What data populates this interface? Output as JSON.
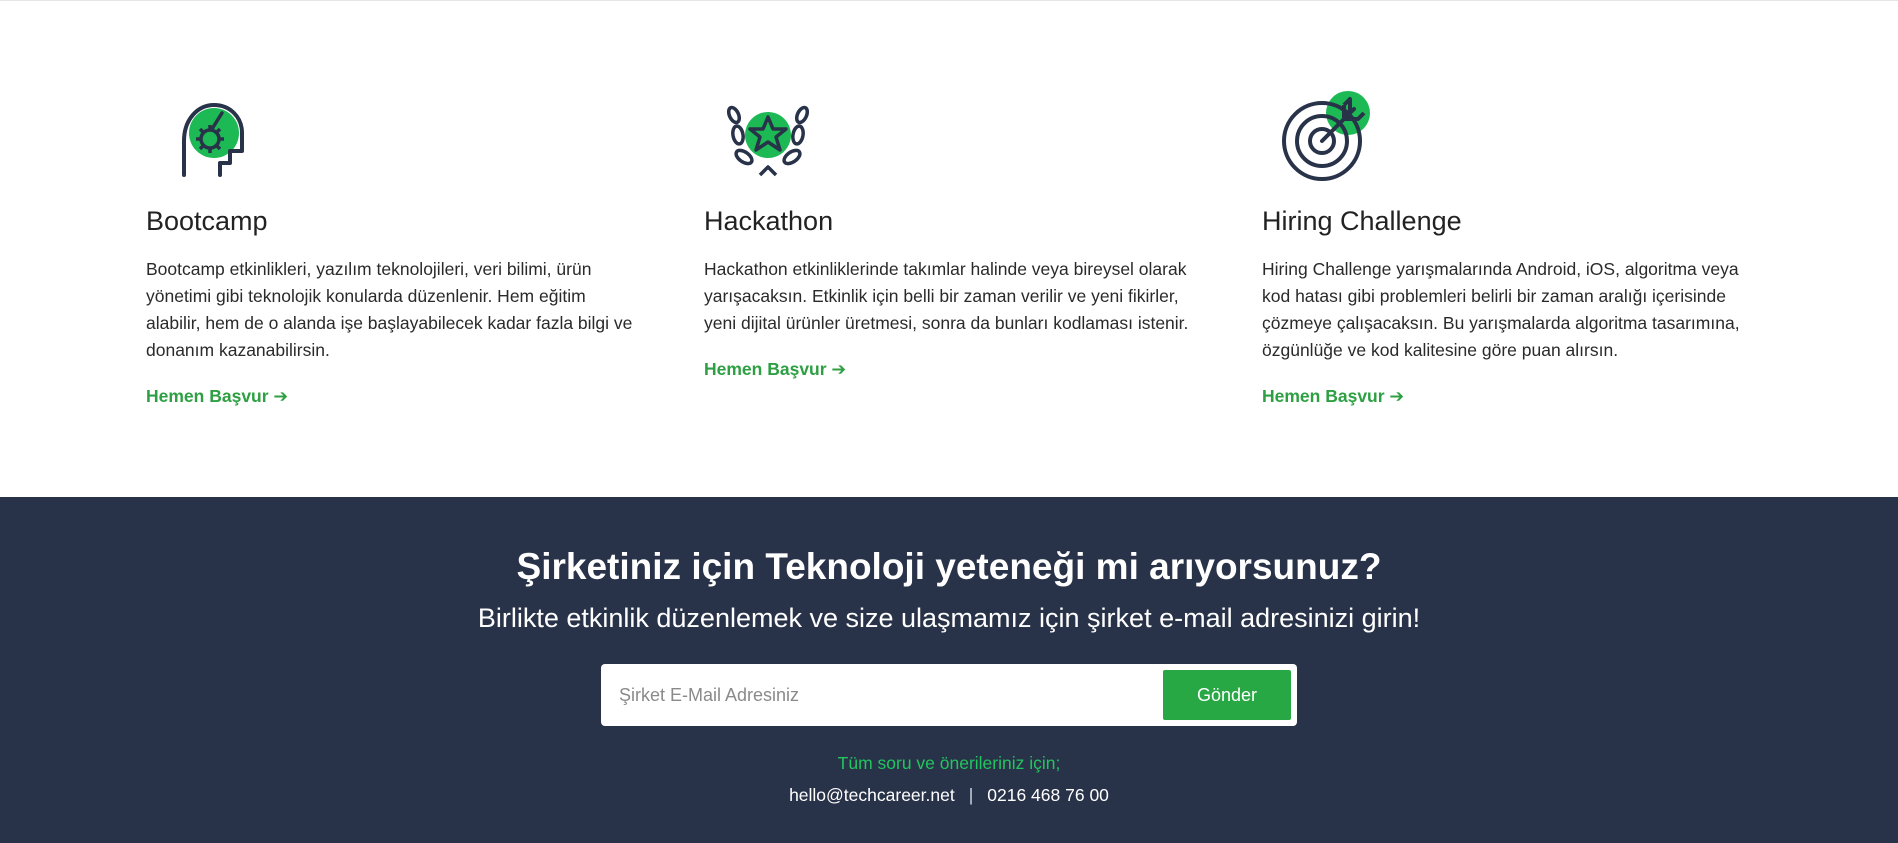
{
  "colors": {
    "accent_green": "#28a745",
    "icon_green": "#1db954",
    "icon_navy": "#283248",
    "cta_background": "#283248"
  },
  "cards": [
    {
      "icon": "head-gear-icon",
      "title": "Bootcamp",
      "text": "Bootcamp etkinlikleri, yazılım teknolojileri, veri bilimi, ürün yönetimi gibi teknolojik konularda düzenlenir. Hem eğitim alabilir, hem de o alanda işe başlayabilecek kadar fazla bilgi ve donanım kazanabilirsin.",
      "link": "Hemen Başvur ➔"
    },
    {
      "icon": "laurel-star-icon",
      "title": "Hackathon",
      "text": "Hackathon etkinliklerinde takımlar halinde veya bireysel olarak yarışacaksın. Etkinlik için belli bir zaman verilir ve yeni fikirler, yeni dijital ürünler üretmesi, sonra da bunları kodlaması istenir.",
      "link": "Hemen Başvur ➔"
    },
    {
      "icon": "target-arrow-icon",
      "title": "Hiring Challenge",
      "text": "Hiring Challenge yarışmalarında Android, iOS, algoritma veya kod hatası gibi problemleri belirli bir zaman aralığı içerisinde çözmeye çalışacaksın. Bu yarışmalarda algoritma tasarımına, özgünlüğe ve kod kalitesine göre puan alırsın.",
      "link": "Hemen Başvur ➔"
    }
  ],
  "cta": {
    "title": "Şirketiniz için Teknoloji yeteneği mi arıyorsunuz?",
    "subtitle": "Birlikte etkinlik düzenlemek ve size ulaşmamız için şirket e-mail adresinizi girin!",
    "email_placeholder": "Şirket E-Mail Adresiniz",
    "email_value": "",
    "submit_label": "Gönder",
    "contact_label": "Tüm soru ve önerileriniz için;",
    "email": "hello@techcareer.net",
    "separator": "|",
    "phone": "0216 468 76 00"
  }
}
